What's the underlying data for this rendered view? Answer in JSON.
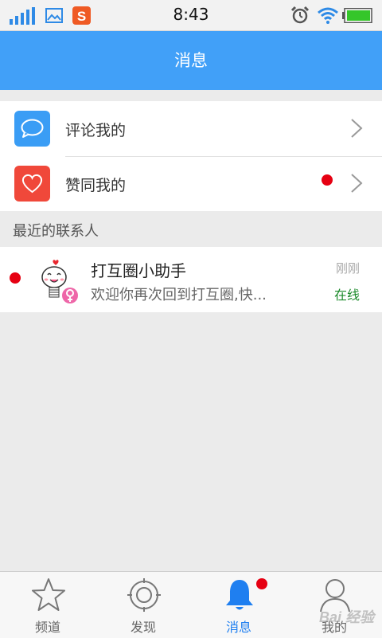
{
  "status_bar": {
    "time": "8:43"
  },
  "header": {
    "title": "消息"
  },
  "menu": {
    "items": [
      {
        "label": "评论我的",
        "icon": "comment-icon",
        "color": "#3a9df5",
        "unread": false
      },
      {
        "label": "赞同我的",
        "icon": "heart-icon",
        "color": "#f0483a",
        "unread": true
      }
    ]
  },
  "recent_contacts": {
    "title": "最近的联系人",
    "items": [
      {
        "name": "打互圈小助手",
        "message": "欢迎你再次回到打互圈,快...",
        "time": "刚刚",
        "status": "在线",
        "unread": true,
        "gender": "female"
      }
    ]
  },
  "tabbar": {
    "tabs": [
      {
        "label": "频道",
        "icon": "star-icon",
        "active": false
      },
      {
        "label": "发现",
        "icon": "discover-icon",
        "active": false
      },
      {
        "label": "消息",
        "icon": "bell-icon",
        "active": true,
        "badge": true
      },
      {
        "label": "我的",
        "icon": "person-icon",
        "active": false
      }
    ]
  },
  "watermark": "Bai 经验",
  "colors": {
    "primary": "#41a0f8",
    "unread_dot": "#e60012",
    "online": "#1b8a2a"
  }
}
